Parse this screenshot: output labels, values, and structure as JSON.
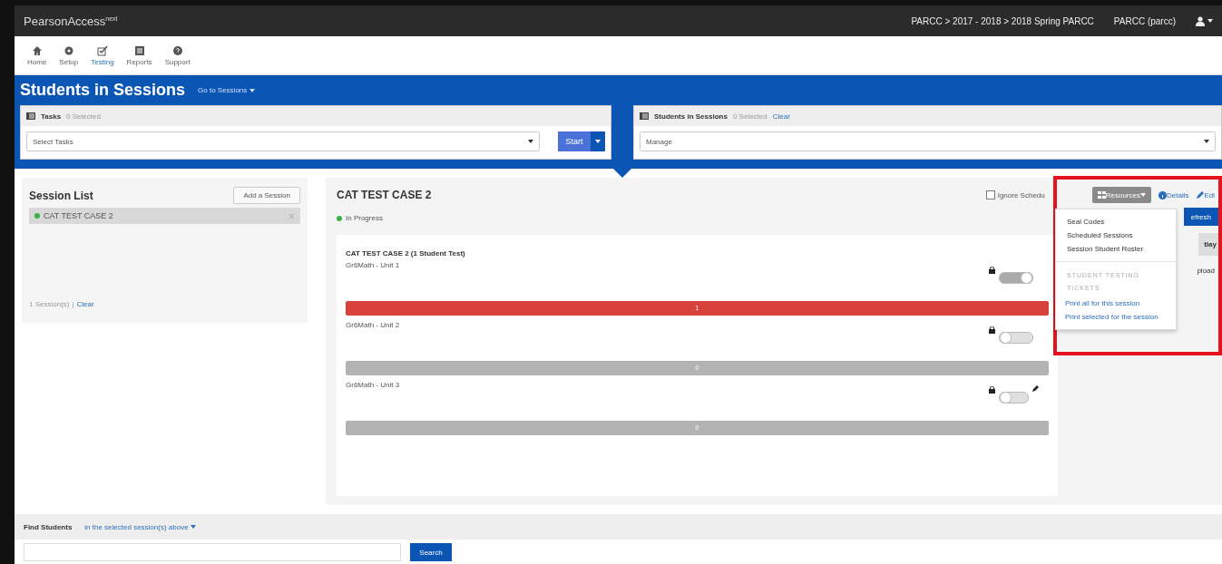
{
  "brand": "PearsonAccess$^{next}$",
  "breadcrumb": "PARCC > 2017 - 2018 > 2018 Spring PARCC",
  "account": "PARCC (parcc)",
  "nav": [
    {
      "label": "Home",
      "selected": false
    },
    {
      "label": "Setup",
      "selected": false
    },
    {
      "label": "Testing",
      "selected": true
    },
    {
      "label": "Reports",
      "selected": false
    },
    {
      "label": "Support",
      "selected": false
    }
  ],
  "page_title": "Students in Sessions",
  "page_menu": "Go to Sessions",
  "tasks_panel": {
    "title": "Tasks",
    "count": "0 Selected",
    "select": "Select Tasks",
    "button": "Start"
  },
  "students_panel": {
    "title": "Students in Sessions",
    "count": "0 Selected",
    "clear": "Clear",
    "select": "Manage"
  },
  "session_list": {
    "title": "Session List",
    "add_button": "Add a Session",
    "items": [
      {
        "name": "CAT TEST CASE 2",
        "color": "#3cb043",
        "selected": true
      }
    ],
    "footer_count": "1 Session(s)",
    "footer_separator": "|",
    "footer_clear": "Clear"
  },
  "session": {
    "title": "CAT TEST CASE 2",
    "status": "In Progress",
    "ignore_schedule": {
      "label": "Ignore Schedu",
      "checked": false
    },
    "resources_button": "Resources",
    "details": "Details",
    "edit": "Edi",
    "side": {
      "button": "efresh",
      "tab": "tlay",
      "text": "pload"
    },
    "card_title": "CAT TEST CASE 2 (1 Student Test)",
    "units": [
      {
        "name": "Gr6Math - Unit 1",
        "on": true,
        "count": "1",
        "color": "#d9413b",
        "edit_icon": false
      },
      {
        "name": "Gr6Math - Unit 2",
        "on": false,
        "count": "0",
        "color": "#b3b3b3",
        "edit_icon": false
      },
      {
        "name": "Gr6Math - Unit 3",
        "on": false,
        "count": "0",
        "color": "#b3b3b3",
        "edit_icon": true
      }
    ]
  },
  "resources_menu": {
    "items": [
      "Seal Codes",
      "Scheduled Sessions",
      "Session Student Roster"
    ],
    "header": "STUDENT TESTING TICKETS",
    "links": [
      "Print all for this session",
      "Print selected for the session"
    ]
  },
  "find_students": {
    "label": "Find Students",
    "scope": "in the selected session(s) above",
    "button": "Search"
  }
}
